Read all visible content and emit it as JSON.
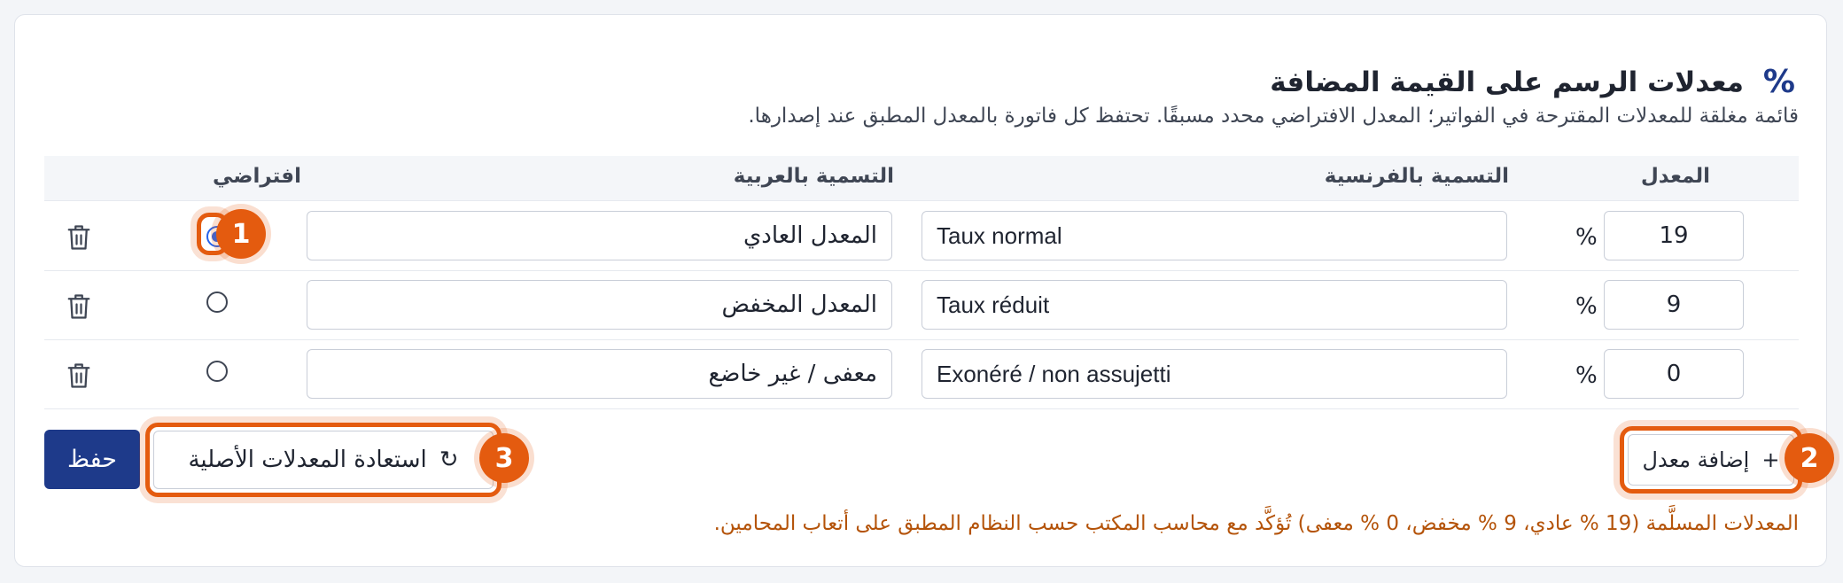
{
  "header": {
    "icon": "percent-icon",
    "icon_glyph": "%",
    "title": "معدلات الرسم على القيمة المضافة",
    "description": "قائمة مغلقة للمعدلات المقترحة في الفواتير؛ المعدل الافتراضي محدد مسبقًا. تحتفظ كل فاتورة بالمعدل المطبق عند إصدارها."
  },
  "table": {
    "columns": {
      "rate": "المعدل",
      "label_fr": "التسمية بالفرنسية",
      "label_ar": "التسمية بالعربية",
      "default": "افتراضي"
    },
    "percent_sign": "%",
    "rows": [
      {
        "rate": "19",
        "label_fr": "Taux normal",
        "label_ar": "المعدل العادي",
        "default": true
      },
      {
        "rate": "9",
        "label_fr": "Taux réduit",
        "label_ar": "المعدل المخفض",
        "default": false
      },
      {
        "rate": "0",
        "label_fr": "Exonéré / non assujetti",
        "label_ar": "معفى / غير خاضع",
        "default": false
      }
    ]
  },
  "actions": {
    "add_label": "إضافة معدل",
    "add_icon": "+",
    "restore_label": "استعادة المعدلات الأصلية",
    "restore_icon": "↻",
    "save_label": "حفظ"
  },
  "note": "المعدلات المسلَّمة (19 % عادي، 9 % مخفض، 0 % معفى) تُؤكَّد مع محاسب المكتب حسب النظام المطبق على أتعاب المحامين.",
  "annotations": [
    "1",
    "2",
    "3"
  ],
  "colors": {
    "accent": "#1e3a8a",
    "highlight": "#e45b0f",
    "note": "#b45309",
    "radio_checked": "#2563eb"
  }
}
